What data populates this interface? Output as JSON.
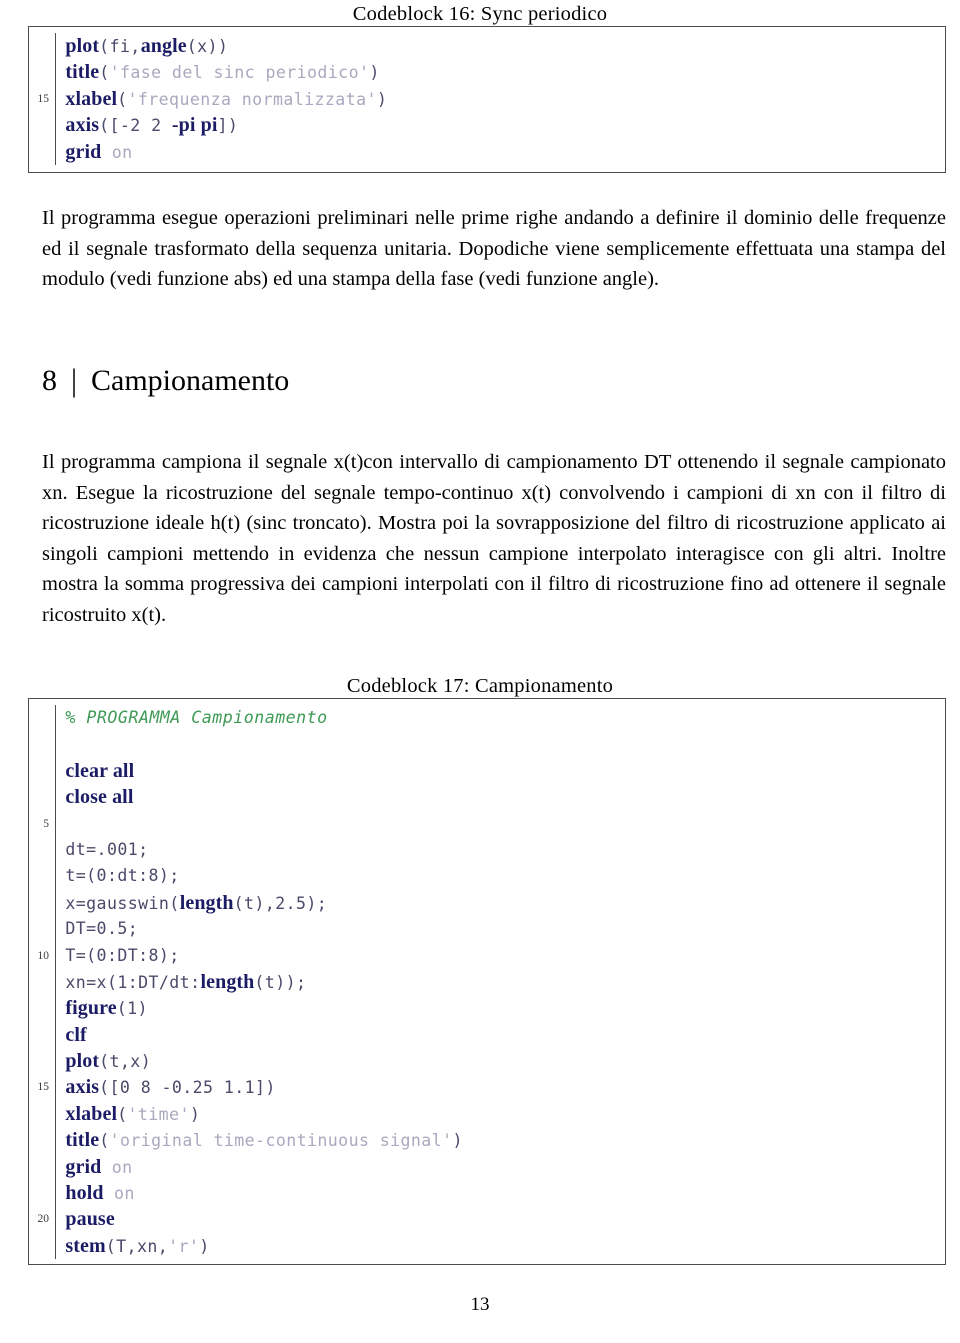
{
  "document": {
    "page_number": "13"
  },
  "codeblock16": {
    "caption": "Codeblock 16: Sync periodico",
    "line_numbers": [
      "",
      "",
      "15",
      "",
      ""
    ],
    "lines": [
      [
        {
          "t": "kw",
          "s": "plot"
        },
        {
          "t": "pl",
          "s": "(fi,"
        },
        {
          "t": "kw",
          "s": "angle"
        },
        {
          "t": "pl",
          "s": "(x))"
        }
      ],
      [
        {
          "t": "kw",
          "s": "title"
        },
        {
          "t": "pl",
          "s": "("
        },
        {
          "t": "str",
          "s": "'fase del sinc periodico'"
        },
        {
          "t": "pl",
          "s": ")"
        }
      ],
      [
        {
          "t": "kw",
          "s": "xlabel"
        },
        {
          "t": "pl",
          "s": "("
        },
        {
          "t": "str",
          "s": "'frequenza normalizzata'"
        },
        {
          "t": "pl",
          "s": ")"
        }
      ],
      [
        {
          "t": "kw",
          "s": "axis"
        },
        {
          "t": "pl",
          "s": "([-2 2 "
        },
        {
          "t": "kw",
          "s": "-pi pi"
        },
        {
          "t": "pl",
          "s": "])"
        }
      ],
      [
        {
          "t": "kw",
          "s": "grid"
        },
        {
          "t": "pl",
          "s": " "
        },
        {
          "t": "str",
          "s": "on"
        }
      ]
    ]
  },
  "paragraph1": "Il programma esegue operazioni preliminari nelle prime righe andando a definire il dominio delle frequenze ed il segnale trasformato della sequenza unitaria. Dopodiche viene semplicemente effettuata una stampa del modulo (vedi funzione abs) ed una stampa della fase (vedi funzione angle).",
  "section": {
    "number": "8",
    "separator": "|",
    "title": "Campionamento"
  },
  "paragraph2": "Il programma campiona il segnale x(t)con intervallo di campionamento DT ottenendo il segnale campionato xn. Esegue la ricostruzione del segnale tempo-continuo x(t) convolvendo i campioni di xn con il filtro di ricostruzione ideale h(t) (sinc troncato). Mostra poi la sovrapposizione del filtro di ricostruzione applicato ai singoli campioni mettendo in evidenza che nessun campione interpolato interagisce con gli altri. Inoltre mostra la somma progressiva dei campioni interpolati con il filtro di ricostruzione fino ad ottenere il segnale ricostruito x(t).",
  "codeblock17": {
    "caption": "Codeblock 17: Campionamento",
    "line_numbers": [
      "",
      "",
      "",
      "",
      "5",
      "",
      "",
      "",
      "",
      "10",
      "",
      "",
      "",
      "",
      "15",
      "",
      "",
      "",
      "",
      "20",
      ""
    ],
    "lines": [
      [
        {
          "t": "cmt",
          "s": "% PROGRAMMA Campionamento"
        }
      ],
      [
        {
          "t": "pl",
          "s": ""
        }
      ],
      [
        {
          "t": "kw",
          "s": "clear all"
        }
      ],
      [
        {
          "t": "kw",
          "s": "close all"
        }
      ],
      [
        {
          "t": "pl",
          "s": ""
        }
      ],
      [
        {
          "t": "pl",
          "s": "dt=.001;"
        }
      ],
      [
        {
          "t": "pl",
          "s": "t=(0:dt:8);"
        }
      ],
      [
        {
          "t": "pl",
          "s": "x=gausswin("
        },
        {
          "t": "kw",
          "s": "length"
        },
        {
          "t": "pl",
          "s": "(t),2.5);"
        }
      ],
      [
        {
          "t": "pl",
          "s": "DT=0.5;"
        }
      ],
      [
        {
          "t": "pl",
          "s": "T=(0:DT:8);"
        }
      ],
      [
        {
          "t": "pl",
          "s": "xn=x(1:DT/dt:"
        },
        {
          "t": "kw",
          "s": "length"
        },
        {
          "t": "pl",
          "s": "(t));"
        }
      ],
      [
        {
          "t": "kw",
          "s": "figure"
        },
        {
          "t": "pl",
          "s": "(1)"
        }
      ],
      [
        {
          "t": "kw",
          "s": "clf"
        }
      ],
      [
        {
          "t": "kw",
          "s": "plot"
        },
        {
          "t": "pl",
          "s": "(t,x)"
        }
      ],
      [
        {
          "t": "kw",
          "s": "axis"
        },
        {
          "t": "pl",
          "s": "([0 8 -0.25 1.1])"
        }
      ],
      [
        {
          "t": "kw",
          "s": "xlabel"
        },
        {
          "t": "pl",
          "s": "("
        },
        {
          "t": "str",
          "s": "'time'"
        },
        {
          "t": "pl",
          "s": ")"
        }
      ],
      [
        {
          "t": "kw",
          "s": "title"
        },
        {
          "t": "pl",
          "s": "("
        },
        {
          "t": "str",
          "s": "'original time-continuous signal'"
        },
        {
          "t": "pl",
          "s": ")"
        }
      ],
      [
        {
          "t": "kw",
          "s": "grid"
        },
        {
          "t": "pl",
          "s": " "
        },
        {
          "t": "str",
          "s": "on"
        }
      ],
      [
        {
          "t": "kw",
          "s": "hold"
        },
        {
          "t": "pl",
          "s": " "
        },
        {
          "t": "str",
          "s": "on"
        }
      ],
      [
        {
          "t": "kw",
          "s": "pause"
        }
      ],
      [
        {
          "t": "kw",
          "s": "stem"
        },
        {
          "t": "pl",
          "s": "(T,xn,"
        },
        {
          "t": "str",
          "s": "'r'"
        },
        {
          "t": "pl",
          "s": ")"
        }
      ]
    ]
  },
  "colors": {
    "keyword": "#1c1c66",
    "plain": "#4a4a6a",
    "string": "#a9a9bf",
    "comment": "#3f9a55",
    "frame": "#4c4c4c"
  }
}
